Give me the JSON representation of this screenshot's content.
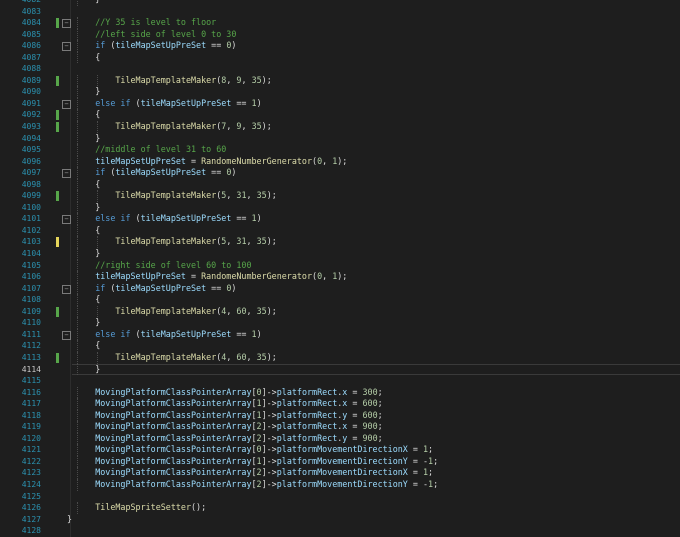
{
  "colors": {
    "background": "#1e1e1e",
    "line_number": "#2b91af",
    "keyword": "#569cd6",
    "comment": "#57a64a",
    "number": "#b5cea8",
    "function": "#dcdcaa",
    "variable": "#9cdcfe",
    "plain": "#dcdcdc",
    "change_saved": "#57a64a",
    "change_unsaved": "#e5d55a"
  },
  "lines": [
    {
      "num": "4082",
      "indent": 3,
      "tokens": [
        [
          "pl",
          "}"
        ]
      ]
    },
    {
      "num": "4083",
      "indent": 0,
      "tokens": []
    },
    {
      "num": "4084",
      "indent": 3,
      "fold": "⊟",
      "change": "green",
      "tokens": [
        [
          "cm",
          "//Y 35 is level to floor"
        ]
      ]
    },
    {
      "num": "4085",
      "indent": 3,
      "tokens": [
        [
          "cm",
          "//left side of level 0 to 30"
        ]
      ]
    },
    {
      "num": "4086",
      "indent": 3,
      "fold": "⊟",
      "tokens": [
        [
          "kw",
          "if"
        ],
        [
          "pl",
          " ("
        ],
        [
          "var",
          "tileMapSetUpPreSet"
        ],
        [
          "pl",
          " == "
        ],
        [
          "nm",
          "0"
        ],
        [
          "pl",
          ")"
        ]
      ]
    },
    {
      "num": "4087",
      "indent": 3,
      "tokens": [
        [
          "pl",
          "{"
        ]
      ]
    },
    {
      "num": "4088",
      "indent": 0,
      "tokens": []
    },
    {
      "num": "4089",
      "indent": 4,
      "change": "green",
      "tokens": [
        [
          "fn",
          "TileMapTemplateMaker"
        ],
        [
          "pl",
          "("
        ],
        [
          "nm",
          "8"
        ],
        [
          "pl",
          ", "
        ],
        [
          "nm",
          "9"
        ],
        [
          "pl",
          ", "
        ],
        [
          "nm",
          "35"
        ],
        [
          "pl",
          ");"
        ]
      ]
    },
    {
      "num": "4090",
      "indent": 3,
      "tokens": [
        [
          "pl",
          "}"
        ]
      ]
    },
    {
      "num": "4091",
      "indent": 3,
      "fold": "⊟",
      "tokens": [
        [
          "kw",
          "else if"
        ],
        [
          "pl",
          " ("
        ],
        [
          "var",
          "tileMapSetUpPreSet"
        ],
        [
          "pl",
          " == "
        ],
        [
          "nm",
          "1"
        ],
        [
          "pl",
          ")"
        ]
      ]
    },
    {
      "num": "4092",
      "indent": 3,
      "change": "green",
      "tokens": [
        [
          "pl",
          "{"
        ]
      ]
    },
    {
      "num": "4093",
      "indent": 4,
      "change": "green",
      "tokens": [
        [
          "fn",
          "TileMapTemplateMaker"
        ],
        [
          "pl",
          "("
        ],
        [
          "nm",
          "7"
        ],
        [
          "pl",
          ", "
        ],
        [
          "nm",
          "9"
        ],
        [
          "pl",
          ", "
        ],
        [
          "nm",
          "35"
        ],
        [
          "pl",
          ");"
        ]
      ]
    },
    {
      "num": "4094",
      "indent": 3,
      "tokens": [
        [
          "pl",
          "}"
        ]
      ]
    },
    {
      "num": "4095",
      "indent": 3,
      "tokens": [
        [
          "cm",
          "//middle of level 31 to 60"
        ]
      ]
    },
    {
      "num": "4096",
      "indent": 3,
      "tokens": [
        [
          "var",
          "tileMapSetUpPreSet"
        ],
        [
          "pl",
          " = "
        ],
        [
          "fn",
          "RandomeNumberGenerator"
        ],
        [
          "pl",
          "("
        ],
        [
          "nm",
          "0"
        ],
        [
          "pl",
          ", "
        ],
        [
          "nm",
          "1"
        ],
        [
          "pl",
          ");"
        ]
      ]
    },
    {
      "num": "4097",
      "indent": 3,
      "fold": "⊟",
      "tokens": [
        [
          "kw",
          "if"
        ],
        [
          "pl",
          " ("
        ],
        [
          "var",
          "tileMapSetUpPreSet"
        ],
        [
          "pl",
          " == "
        ],
        [
          "nm",
          "0"
        ],
        [
          "pl",
          ")"
        ]
      ]
    },
    {
      "num": "4098",
      "indent": 3,
      "tokens": [
        [
          "pl",
          "{"
        ]
      ]
    },
    {
      "num": "4099",
      "indent": 4,
      "change": "green",
      "tokens": [
        [
          "fn",
          "TileMapTemplateMaker"
        ],
        [
          "pl",
          "("
        ],
        [
          "nm",
          "5"
        ],
        [
          "pl",
          ", "
        ],
        [
          "nm",
          "31"
        ],
        [
          "pl",
          ", "
        ],
        [
          "nm",
          "35"
        ],
        [
          "pl",
          ");"
        ]
      ]
    },
    {
      "num": "4100",
      "indent": 3,
      "tokens": [
        [
          "pl",
          "}"
        ]
      ]
    },
    {
      "num": "4101",
      "indent": 3,
      "fold": "⊟",
      "tokens": [
        [
          "kw",
          "else if"
        ],
        [
          "pl",
          " ("
        ],
        [
          "var",
          "tileMapSetUpPreSet"
        ],
        [
          "pl",
          " == "
        ],
        [
          "nm",
          "1"
        ],
        [
          "pl",
          ")"
        ]
      ]
    },
    {
      "num": "4102",
      "indent": 3,
      "tokens": [
        [
          "pl",
          "{"
        ]
      ]
    },
    {
      "num": "4103",
      "indent": 4,
      "change": "yellow",
      "tokens": [
        [
          "fn",
          "TileMapTemplateMaker"
        ],
        [
          "pl",
          "("
        ],
        [
          "nm",
          "5"
        ],
        [
          "pl",
          ", "
        ],
        [
          "nm",
          "31"
        ],
        [
          "pl",
          ", "
        ],
        [
          "nm",
          "35"
        ],
        [
          "pl",
          ");"
        ]
      ]
    },
    {
      "num": "4104",
      "indent": 3,
      "tokens": [
        [
          "pl",
          "}"
        ]
      ]
    },
    {
      "num": "4105",
      "indent": 3,
      "tokens": [
        [
          "cm",
          "//right side of level 60 to 100"
        ]
      ]
    },
    {
      "num": "4106",
      "indent": 3,
      "tokens": [
        [
          "var",
          "tileMapSetUpPreSet"
        ],
        [
          "pl",
          " = "
        ],
        [
          "fn",
          "RandomeNumberGenerator"
        ],
        [
          "pl",
          "("
        ],
        [
          "nm",
          "0"
        ],
        [
          "pl",
          ", "
        ],
        [
          "nm",
          "1"
        ],
        [
          "pl",
          ");"
        ]
      ]
    },
    {
      "num": "4107",
      "indent": 3,
      "fold": "⊟",
      "tokens": [
        [
          "kw",
          "if"
        ],
        [
          "pl",
          " ("
        ],
        [
          "var",
          "tileMapSetUpPreSet"
        ],
        [
          "pl",
          " == "
        ],
        [
          "nm",
          "0"
        ],
        [
          "pl",
          ")"
        ]
      ]
    },
    {
      "num": "4108",
      "indent": 3,
      "tokens": [
        [
          "pl",
          "{"
        ]
      ]
    },
    {
      "num": "4109",
      "indent": 4,
      "change": "green",
      "tokens": [
        [
          "fn",
          "TileMapTemplateMaker"
        ],
        [
          "pl",
          "("
        ],
        [
          "nm",
          "4"
        ],
        [
          "pl",
          ", "
        ],
        [
          "nm",
          "60"
        ],
        [
          "pl",
          ", "
        ],
        [
          "nm",
          "35"
        ],
        [
          "pl",
          ");"
        ]
      ]
    },
    {
      "num": "4110",
      "indent": 3,
      "tokens": [
        [
          "pl",
          "}"
        ]
      ]
    },
    {
      "num": "4111",
      "indent": 3,
      "fold": "⊟",
      "tokens": [
        [
          "kw",
          "else if"
        ],
        [
          "pl",
          " ("
        ],
        [
          "var",
          "tileMapSetUpPreSet"
        ],
        [
          "pl",
          " == "
        ],
        [
          "nm",
          "1"
        ],
        [
          "pl",
          ")"
        ]
      ]
    },
    {
      "num": "4112",
      "indent": 3,
      "tokens": [
        [
          "pl",
          "{"
        ]
      ]
    },
    {
      "num": "4113",
      "indent": 4,
      "change": "green",
      "tokens": [
        [
          "fn",
          "TileMapTemplateMaker"
        ],
        [
          "pl",
          "("
        ],
        [
          "nm",
          "4"
        ],
        [
          "pl",
          ", "
        ],
        [
          "nm",
          "60"
        ],
        [
          "pl",
          ", "
        ],
        [
          "nm",
          "35"
        ],
        [
          "pl",
          ");"
        ]
      ]
    },
    {
      "num": "4114",
      "indent": 3,
      "current": true,
      "tokens": [
        [
          "pl",
          "}"
        ]
      ]
    },
    {
      "num": "4115",
      "indent": 0,
      "tokens": []
    },
    {
      "num": "4116",
      "indent": 3,
      "tokens": [
        [
          "var",
          "MovingPlatformClassPointerArray"
        ],
        [
          "pl",
          "["
        ],
        [
          "nm",
          "0"
        ],
        [
          "pl",
          "]->"
        ],
        [
          "var",
          "platformRect"
        ],
        [
          "pl",
          "."
        ],
        [
          "var",
          "x"
        ],
        [
          "pl",
          " = "
        ],
        [
          "nm",
          "300"
        ],
        [
          "pl",
          ";"
        ]
      ]
    },
    {
      "num": "4117",
      "indent": 3,
      "tokens": [
        [
          "var",
          "MovingPlatformClassPointerArray"
        ],
        [
          "pl",
          "["
        ],
        [
          "nm",
          "1"
        ],
        [
          "pl",
          "]->"
        ],
        [
          "var",
          "platformRect"
        ],
        [
          "pl",
          "."
        ],
        [
          "var",
          "x"
        ],
        [
          "pl",
          " = "
        ],
        [
          "nm",
          "600"
        ],
        [
          "pl",
          ";"
        ]
      ]
    },
    {
      "num": "4118",
      "indent": 3,
      "tokens": [
        [
          "var",
          "MovingPlatformClassPointerArray"
        ],
        [
          "pl",
          "["
        ],
        [
          "nm",
          "1"
        ],
        [
          "pl",
          "]->"
        ],
        [
          "var",
          "platformRect"
        ],
        [
          "pl",
          "."
        ],
        [
          "var",
          "y"
        ],
        [
          "pl",
          " = "
        ],
        [
          "nm",
          "600"
        ],
        [
          "pl",
          ";"
        ]
      ]
    },
    {
      "num": "4119",
      "indent": 3,
      "tokens": [
        [
          "var",
          "MovingPlatformClassPointerArray"
        ],
        [
          "pl",
          "["
        ],
        [
          "nm",
          "2"
        ],
        [
          "pl",
          "]->"
        ],
        [
          "var",
          "platformRect"
        ],
        [
          "pl",
          "."
        ],
        [
          "var",
          "x"
        ],
        [
          "pl",
          " = "
        ],
        [
          "nm",
          "900"
        ],
        [
          "pl",
          ";"
        ]
      ]
    },
    {
      "num": "4120",
      "indent": 3,
      "tokens": [
        [
          "var",
          "MovingPlatformClassPointerArray"
        ],
        [
          "pl",
          "["
        ],
        [
          "nm",
          "2"
        ],
        [
          "pl",
          "]->"
        ],
        [
          "var",
          "platformRect"
        ],
        [
          "pl",
          "."
        ],
        [
          "var",
          "y"
        ],
        [
          "pl",
          " = "
        ],
        [
          "nm",
          "900"
        ],
        [
          "pl",
          ";"
        ]
      ]
    },
    {
      "num": "4121",
      "indent": 3,
      "tokens": [
        [
          "var",
          "MovingPlatformClassPointerArray"
        ],
        [
          "pl",
          "["
        ],
        [
          "nm",
          "0"
        ],
        [
          "pl",
          "]->"
        ],
        [
          "var",
          "platformMovementDirectionX"
        ],
        [
          "pl",
          " = "
        ],
        [
          "nm",
          "1"
        ],
        [
          "pl",
          ";"
        ]
      ]
    },
    {
      "num": "4122",
      "indent": 3,
      "tokens": [
        [
          "var",
          "MovingPlatformClassPointerArray"
        ],
        [
          "pl",
          "["
        ],
        [
          "nm",
          "1"
        ],
        [
          "pl",
          "]->"
        ],
        [
          "var",
          "platformMovementDirectionY"
        ],
        [
          "pl",
          " = -"
        ],
        [
          "nm",
          "1"
        ],
        [
          "pl",
          ";"
        ]
      ]
    },
    {
      "num": "4123",
      "indent": 3,
      "tokens": [
        [
          "var",
          "MovingPlatformClassPointerArray"
        ],
        [
          "pl",
          "["
        ],
        [
          "nm",
          "2"
        ],
        [
          "pl",
          "]->"
        ],
        [
          "var",
          "platformMovementDirectionX"
        ],
        [
          "pl",
          " = "
        ],
        [
          "nm",
          "1"
        ],
        [
          "pl",
          ";"
        ]
      ]
    },
    {
      "num": "4124",
      "indent": 3,
      "tokens": [
        [
          "var",
          "MovingPlatformClassPointerArray"
        ],
        [
          "pl",
          "["
        ],
        [
          "nm",
          "2"
        ],
        [
          "pl",
          "]->"
        ],
        [
          "var",
          "platformMovementDirectionY"
        ],
        [
          "pl",
          " = -"
        ],
        [
          "nm",
          "1"
        ],
        [
          "pl",
          ";"
        ]
      ]
    },
    {
      "num": "4125",
      "indent": 0,
      "tokens": []
    },
    {
      "num": "4126",
      "indent": 3,
      "tokens": [
        [
          "fn",
          "TileMapSpriteSetter"
        ],
        [
          "pl",
          "();"
        ]
      ]
    },
    {
      "num": "4127",
      "indent": 1,
      "tokens": [
        [
          "pl",
          "}"
        ]
      ]
    },
    {
      "num": "4128",
      "indent": 0,
      "tokens": []
    }
  ]
}
